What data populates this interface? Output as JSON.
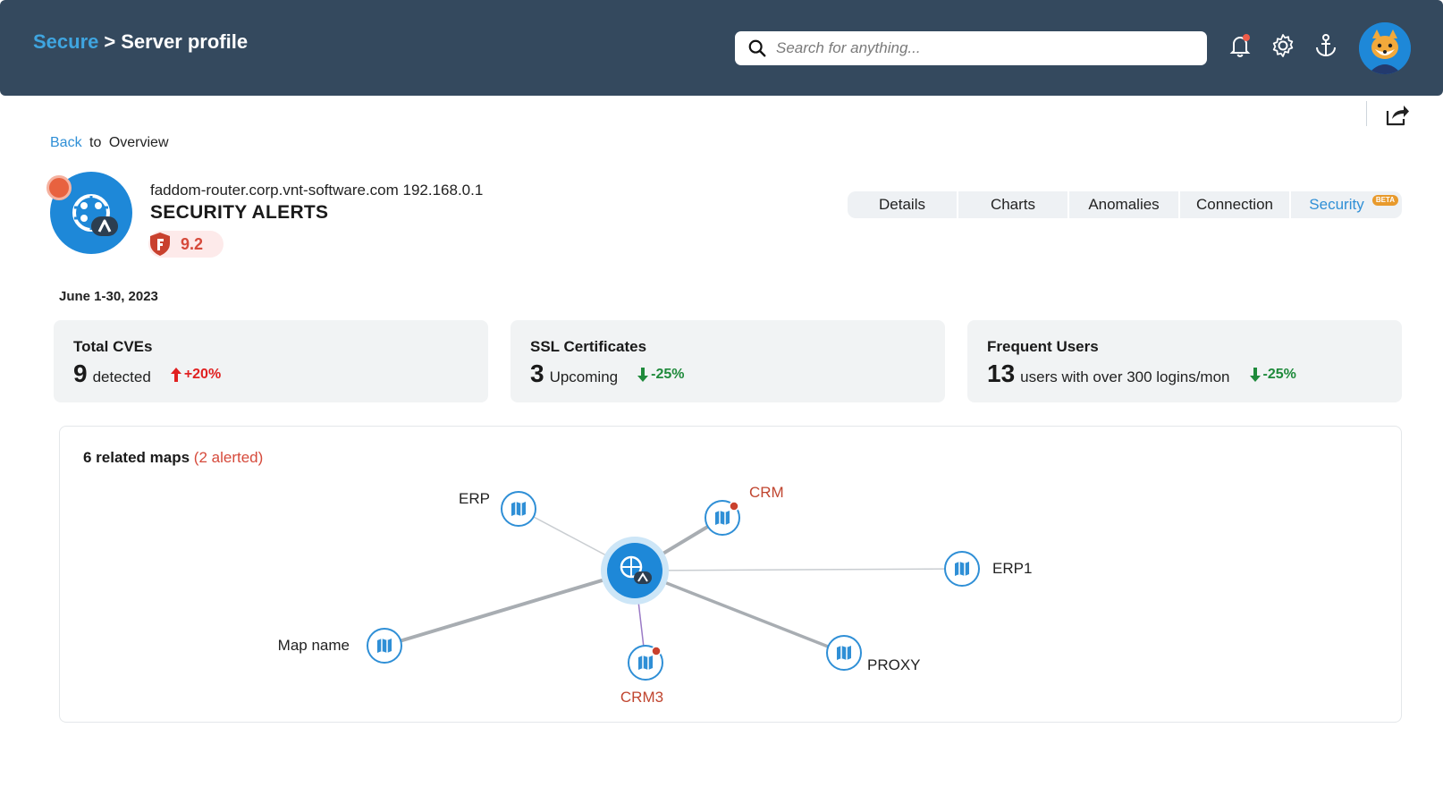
{
  "header": {
    "breadcrumb_root": "Secure",
    "breadcrumb_separator": ">",
    "breadcrumb_current": "Server profile",
    "search_placeholder": "Search for anything...",
    "icons": [
      "bell-icon",
      "gear-icon",
      "anchor-icon",
      "avatar"
    ]
  },
  "nav": {
    "back_label": "Back",
    "back_suffix": "to",
    "back_target": "Overview"
  },
  "server": {
    "hostname_ip": "faddom-router.corp.vnt-software.com 192.168.0.1",
    "title": "SECURITY ALERTS",
    "risk_score": "9.2"
  },
  "tabs": [
    {
      "label": "Details"
    },
    {
      "label": "Charts"
    },
    {
      "label": "Anomalies"
    },
    {
      "label": "Connection"
    },
    {
      "label": "Security",
      "badge": "BETA",
      "active": true
    }
  ],
  "period": "June 1-30, 2023",
  "stats": [
    {
      "title": "Total CVEs",
      "value": "9",
      "unit": "detected",
      "delta": "+20%",
      "direction": "up",
      "color": "#e02020"
    },
    {
      "title": "SSL Certificates",
      "value": "3",
      "unit": "Upcoming",
      "delta": "-25%",
      "direction": "down",
      "color": "#1f8a3b"
    },
    {
      "title": "Frequent Users",
      "value": "13",
      "unit": "users with over 300 logins/mon",
      "delta": "-25%",
      "direction": "down",
      "color": "#1f8a3b"
    }
  ],
  "maps": {
    "count_label": "6 related maps",
    "alerted_label": "(2 alerted)",
    "nodes": [
      {
        "label": "ERP",
        "alerted": false
      },
      {
        "label": "CRM",
        "alerted": true
      },
      {
        "label": "ERP1",
        "alerted": false
      },
      {
        "label": "PROXY",
        "alerted": false
      },
      {
        "label": "CRM3",
        "alerted": true
      },
      {
        "label": "Map name",
        "alerted": false
      }
    ]
  },
  "colors": {
    "header_bg": "#34495e",
    "accent": "#2f8fd6",
    "alert": "#d64a3b",
    "positive": "#1f8a3b"
  }
}
